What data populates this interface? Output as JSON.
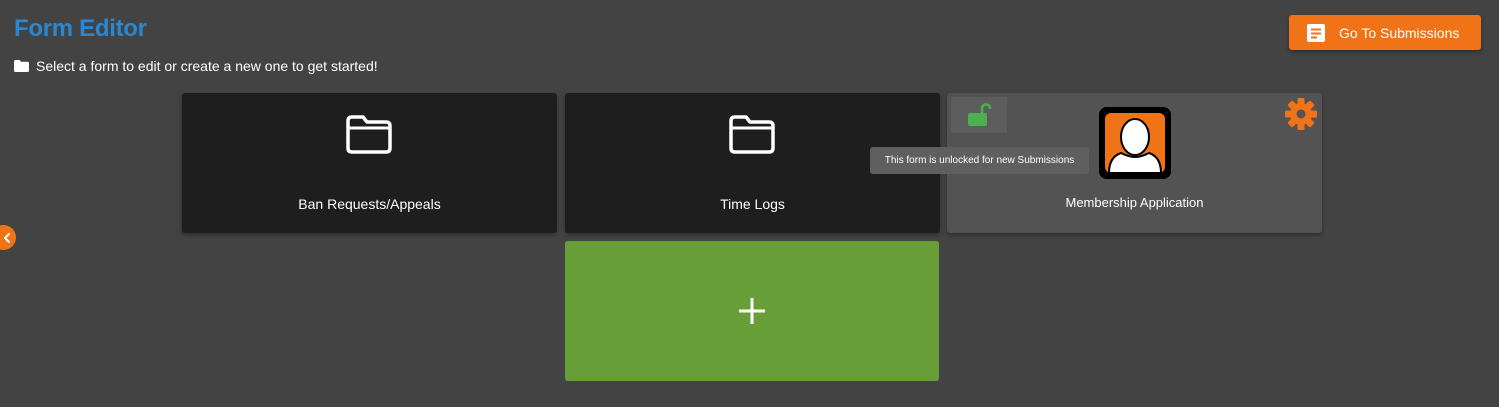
{
  "header": {
    "title": "Form Editor",
    "subtitle": "Select a form to edit or create a new one to get started!",
    "subtitle_icon": "folder-icon",
    "go_to_submissions_label": "Go To Submissions",
    "go_to_submissions_icon": "document-icon"
  },
  "forms": [
    {
      "label": "Ban Requests/Appeals",
      "icon": "folder-icon"
    },
    {
      "label": "Time Logs",
      "icon": "folder-icon"
    },
    {
      "label": "Membership Application",
      "image": "user-avatar-icon",
      "lock_state": "unlocked",
      "lock_icon": "unlock-icon",
      "settings_icon": "gear-icon",
      "tooltip": "This form is unlocked for new Submissions"
    }
  ],
  "add_form": {
    "icon": "plus-icon"
  },
  "sidebar_toggle": {
    "icon": "chevron-left-icon"
  },
  "colors": {
    "background": "#434343",
    "title": "#2b87cf",
    "accent": "#f07318",
    "card": "#1e1e1e",
    "card_highlight": "#535353",
    "add_card": "#679e37",
    "unlock_green": "#4caf50"
  }
}
